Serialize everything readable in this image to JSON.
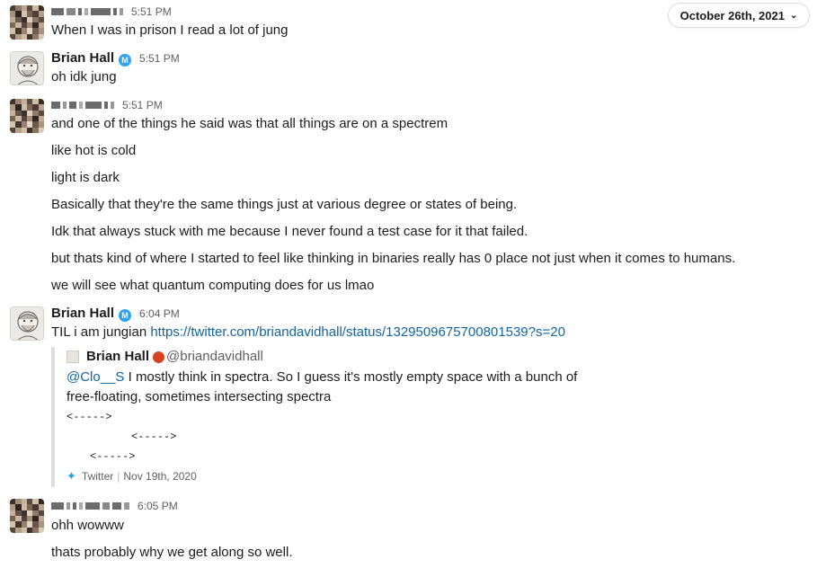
{
  "date_pill": {
    "label": "October 26th, 2021",
    "icon": "chevron-down-icon"
  },
  "colors": {
    "link": "#1264a3",
    "badge": "#2ea3f2",
    "muted": "#616061"
  },
  "messages": [
    {
      "author": "",
      "time": "5:51 PM",
      "lines": [
        "When I was in prison I read a lot of jung"
      ]
    },
    {
      "author": "Brian Hall",
      "badge": "M",
      "time": "5:51 PM",
      "lines": [
        "oh idk jung"
      ]
    },
    {
      "author": "",
      "time": "5:51 PM",
      "lines": [
        "and one of the things he said was that all things are on a spectrem",
        "like hot is cold",
        "light is dark",
        "Basically that they're the same things just at various degree or states of being.",
        "Idk that always stuck with me because I never found a test case for it that failed.",
        "but thats kind of where I started to feel like thinking in binaries really has 0 place not just when it comes to humans.",
        "we will see what quantum computing does for us lmao"
      ]
    },
    {
      "author": "Brian Hall",
      "badge": "M",
      "time": "6:04 PM",
      "text_prefix": "TIL i am jungian ",
      "link": "https://twitter.com/briandavidhall/status/1329509675700801539?s=20"
    },
    {
      "author": "",
      "time": "6:05 PM",
      "lines": [
        "ohh wowww",
        "thats probably why we get along so well."
      ]
    }
  ],
  "attachment": {
    "author": "Brian Hall",
    "handle": "@briandavidhall",
    "mention": "@Clo__S",
    "text1": " I mostly think in spectra. So I guess it's mostly empty space with a bunch of",
    "text2": "free-floating, sometimes intersecting spectra",
    "arrow": "<----->",
    "source": "Twitter",
    "date": "Nov 19th, 2020"
  }
}
